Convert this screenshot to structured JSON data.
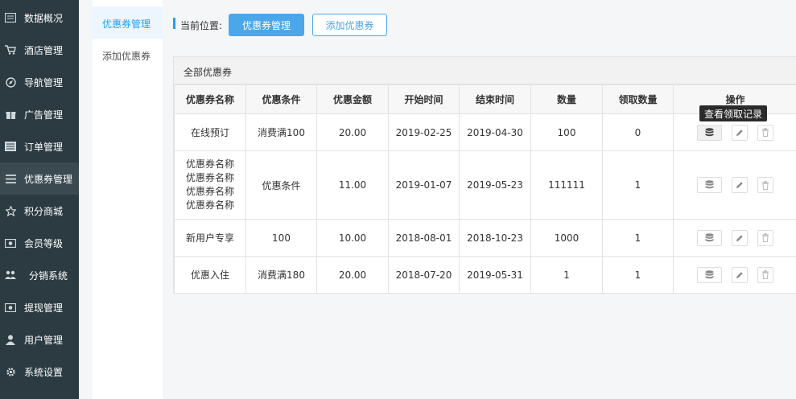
{
  "sidebar": {
    "items": [
      {
        "label": "数据概况",
        "icon": "dashboard-icon"
      },
      {
        "label": "酒店管理",
        "icon": "cart-icon"
      },
      {
        "label": "导航管理",
        "icon": "compass-icon"
      },
      {
        "label": "广告管理",
        "icon": "gift-icon"
      },
      {
        "label": "订单管理",
        "icon": "list-icon"
      },
      {
        "label": "优惠券管理",
        "icon": "menu-icon"
      },
      {
        "label": "积分商城",
        "icon": "star-icon"
      },
      {
        "label": "会员等级",
        "icon": "money-icon"
      },
      {
        "label": "分销系统",
        "icon": "users-icon"
      },
      {
        "label": "提现管理",
        "icon": "cash-icon"
      },
      {
        "label": "用户管理",
        "icon": "user-icon"
      },
      {
        "label": "系统设置",
        "icon": "gear-icon"
      }
    ]
  },
  "submenu": {
    "items": [
      {
        "label": "优惠券管理"
      },
      {
        "label": "添加优惠券"
      }
    ]
  },
  "breadcrumb": {
    "label": "当前位置:",
    "current_button": "优惠券管理",
    "add_button": "添加优惠券"
  },
  "panel": {
    "title": "全部优惠券"
  },
  "table": {
    "headers": [
      "优惠券名称",
      "优惠条件",
      "优惠金额",
      "开始时间",
      "结束时间",
      "数量",
      "领取数量",
      "操作"
    ],
    "rows": [
      {
        "name": [
          "在线预订"
        ],
        "condition": "消费满100",
        "amount": "20.00",
        "start": "2019-02-25",
        "end": "2019-04-30",
        "qty": "100",
        "claimed": "0"
      },
      {
        "name": [
          "优惠券名称",
          "优惠券名称",
          "优惠券名称",
          "优惠券名称"
        ],
        "condition": "优惠条件",
        "amount": "11.00",
        "start": "2019-01-07",
        "end": "2019-05-23",
        "qty": "111111",
        "claimed": "1"
      },
      {
        "name": [
          "新用户专享"
        ],
        "condition": "100",
        "amount": "10.00",
        "start": "2018-08-01",
        "end": "2018-10-23",
        "qty": "1000",
        "claimed": "1"
      },
      {
        "name": [
          "优惠入住"
        ],
        "condition": "消费满180",
        "amount": "20.00",
        "start": "2018-07-20",
        "end": "2019-05-31",
        "qty": "1",
        "claimed": "1"
      }
    ]
  },
  "tooltip": {
    "text": "查看领取记录"
  },
  "colors": {
    "sidebar_bg": "#2c3b41",
    "accent": "#4ba7ea"
  }
}
